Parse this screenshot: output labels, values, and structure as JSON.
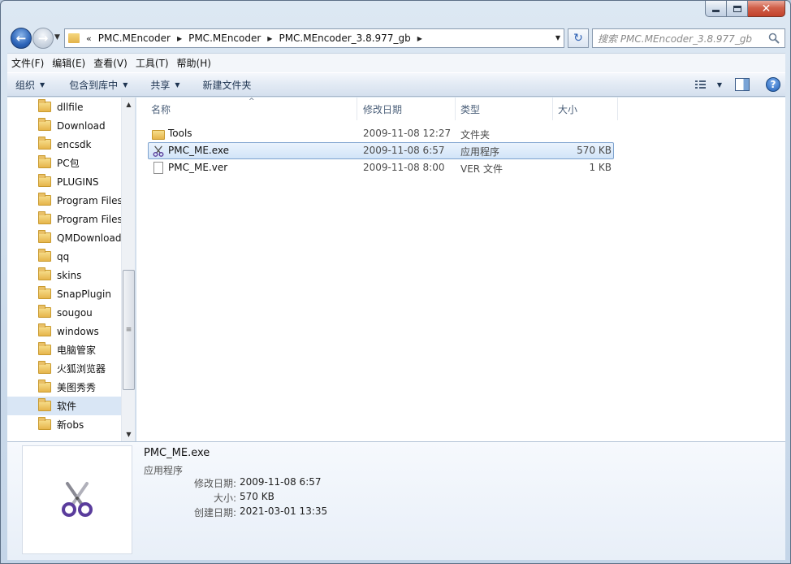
{
  "window": {
    "caption": {
      "minimize": "",
      "maximize": "",
      "close": "✕"
    }
  },
  "nav": {
    "back": "←",
    "forward": "→",
    "history": "▼"
  },
  "address": {
    "lead": "«",
    "crumbs": [
      "PMC.MEncoder",
      "PMC.MEncoder",
      "PMC.MEncoder_3.8.977_gb"
    ],
    "arrow": "▶",
    "dropdown": "▼",
    "refresh": "↻"
  },
  "search": {
    "placeholder": "搜索 PMC.MEncoder_3.8.977_gb"
  },
  "menubar": [
    "文件(F)",
    "编辑(E)",
    "查看(V)",
    "工具(T)",
    "帮助(H)"
  ],
  "toolbar": {
    "organize": "组织",
    "include_library": "包含到库中",
    "share": "共享",
    "new_folder": "新建文件夹",
    "dropdown": "▼",
    "help": "?"
  },
  "navpane": {
    "items": [
      "dllfile",
      "Download",
      "encsdk",
      "PC包",
      "PLUGINS",
      "Program Files",
      "Program Files",
      "QMDownload",
      "qq",
      "skins",
      "SnapPlugin",
      "sougou",
      "windows",
      "电脑管家",
      "火狐浏览器",
      "美图秀秀",
      "软件",
      "新obs"
    ],
    "selected_index": 16,
    "scroll": {
      "up": "▲",
      "down": "▼",
      "grip": "≡"
    }
  },
  "columns": {
    "name": "名称",
    "modified": "修改日期",
    "type": "类型",
    "size": "大小",
    "sort_glyph": "^"
  },
  "files": [
    {
      "name": "Tools",
      "modified": "2009-11-08 12:27",
      "type": "文件夹",
      "size": "",
      "icon": "folder-icon"
    },
    {
      "name": "PMC_ME.exe",
      "modified": "2009-11-08 6:57",
      "type": "应用程序",
      "size": "570 KB",
      "icon": "scissors-icon"
    },
    {
      "name": "PMC_ME.ver",
      "modified": "2009-11-08 8:00",
      "type": "VER 文件",
      "size": "1 KB",
      "icon": "document-icon"
    }
  ],
  "selected_file": 1,
  "details": {
    "name": "PMC_ME.exe",
    "type": "应用程序",
    "modified_label": "修改日期:",
    "modified_value": "2009-11-08 6:57",
    "size_label": "大小:",
    "size_value": "570 KB",
    "created_label": "创建日期:",
    "created_value": "2021-03-01 13:35"
  },
  "colors": {
    "accent": "#2c64b8",
    "selection": "#d2e4f8",
    "close": "#c2412a"
  }
}
